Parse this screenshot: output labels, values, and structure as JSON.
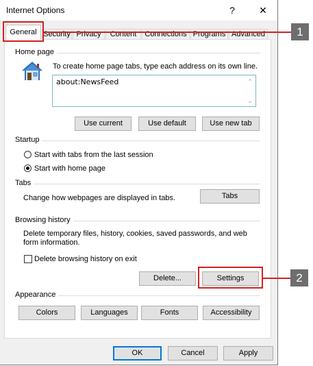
{
  "window": {
    "title": "Internet Options",
    "help_glyph": "?",
    "close_glyph": "✕"
  },
  "tabs": [
    {
      "label": "General"
    },
    {
      "label": "Security"
    },
    {
      "label": "Privacy"
    },
    {
      "label": "Content"
    },
    {
      "label": "Connections"
    },
    {
      "label": "Programs"
    },
    {
      "label": "Advanced"
    }
  ],
  "home_page": {
    "group_label": "Home page",
    "icon": "house-icon",
    "instruction": "To create home page tabs, type each address on its own line.",
    "address_value": "about:NewsFeed",
    "buttons": {
      "use_current": "Use current",
      "use_default": "Use default",
      "use_new_tab": "Use new tab"
    }
  },
  "startup": {
    "group_label": "Startup",
    "option_last_session": "Start with tabs from the last session",
    "option_home_page": "Start with home page",
    "selected": "home_page"
  },
  "tabs_group": {
    "group_label": "Tabs",
    "description": "Change how webpages are displayed in tabs.",
    "button": "Tabs"
  },
  "browsing_history": {
    "group_label": "Browsing history",
    "description_line1": "Delete temporary files, history, cookies, saved passwords, and web",
    "description_line2": "form information.",
    "checkbox_label": "Delete browsing history on exit",
    "checkbox_checked": false,
    "delete_button": "Delete...",
    "settings_button": "Settings"
  },
  "appearance": {
    "group_label": "Appearance",
    "buttons": {
      "colors": "Colors",
      "languages": "Languages",
      "fonts": "Fonts",
      "accessibility": "Accessibility"
    }
  },
  "footer": {
    "ok": "OK",
    "cancel": "Cancel",
    "apply": "Apply"
  },
  "callouts": [
    {
      "number": "1"
    },
    {
      "number": "2"
    }
  ],
  "colors": {
    "callout_red": "#d42020",
    "callout_badge": "#6e6e6e",
    "ok_border": "#0078d7"
  }
}
